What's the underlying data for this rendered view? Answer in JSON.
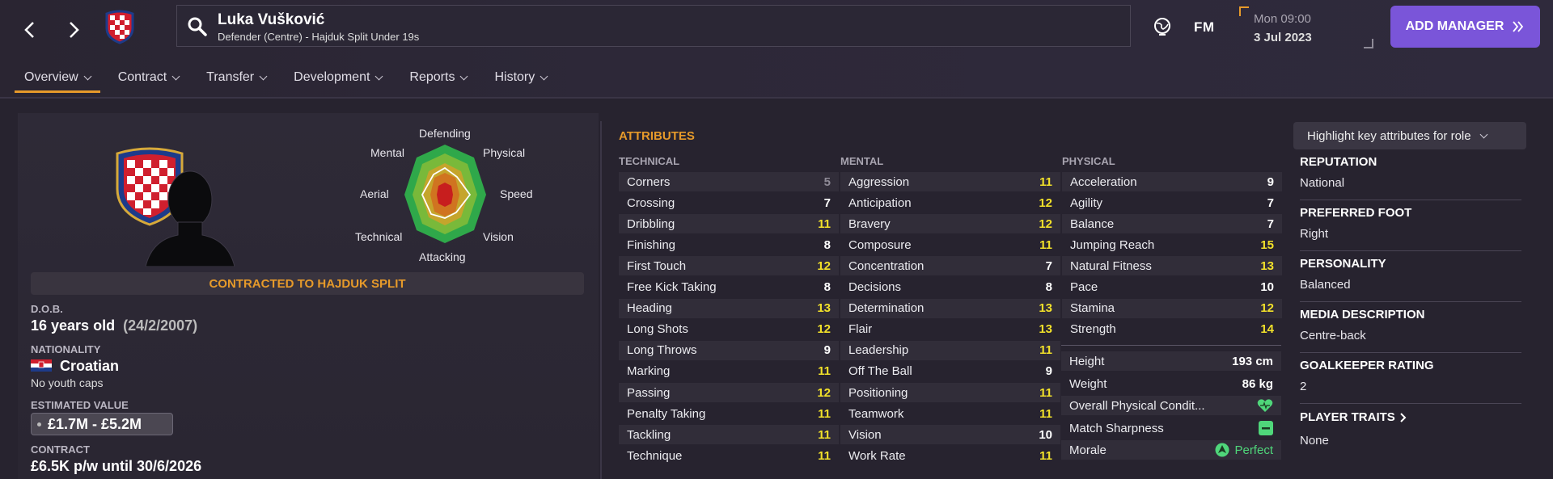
{
  "header": {
    "player_name": "Luka Vušković",
    "player_sub": "Defender (Centre) - Hajduk Split Under 19s",
    "logo_text": "FM",
    "date_day": "Mon 09:00",
    "date_date": "3 Jul 2023",
    "add_manager_label": "ADD MANAGER",
    "add_manager_color": "#7a55d9"
  },
  "tabs": [
    {
      "label": "Overview"
    },
    {
      "label": "Contract"
    },
    {
      "label": "Transfer"
    },
    {
      "label": "Development"
    },
    {
      "label": "Reports"
    },
    {
      "label": "History"
    }
  ],
  "radar": {
    "labels": {
      "defending": "Defending",
      "physical": "Physical",
      "speed": "Speed",
      "vision": "Vision",
      "attacking": "Attacking",
      "technical": "Technical",
      "aerial": "Aerial",
      "mental": "Mental"
    }
  },
  "profile": {
    "contracted_label": "CONTRACTED TO HAJDUK SPLIT",
    "dob_label": "D.O.B.",
    "age": "16 years old",
    "dob": "(24/2/2007)",
    "nationality_label": "NATIONALITY",
    "nationality": "Croatian",
    "caps": "No youth caps",
    "value_label": "ESTIMATED VALUE",
    "value": "£1.7M - £5.2M",
    "contract_label": "CONTRACT",
    "contract": "£6.5K p/w until 30/6/2026"
  },
  "attributes": {
    "title": "ATTRIBUTES",
    "technical_label": "TECHNICAL",
    "mental_label": "MENTAL",
    "physical_label": "PHYSICAL",
    "technical": [
      {
        "name": "Corners",
        "value": "5"
      },
      {
        "name": "Crossing",
        "value": "7"
      },
      {
        "name": "Dribbling",
        "value": "11"
      },
      {
        "name": "Finishing",
        "value": "8"
      },
      {
        "name": "First Touch",
        "value": "12"
      },
      {
        "name": "Free Kick Taking",
        "value": "8"
      },
      {
        "name": "Heading",
        "value": "13"
      },
      {
        "name": "Long Shots",
        "value": "12"
      },
      {
        "name": "Long Throws",
        "value": "9"
      },
      {
        "name": "Marking",
        "value": "11"
      },
      {
        "name": "Passing",
        "value": "12"
      },
      {
        "name": "Penalty Taking",
        "value": "11"
      },
      {
        "name": "Tackling",
        "value": "11"
      },
      {
        "name": "Technique",
        "value": "11"
      }
    ],
    "mental": [
      {
        "name": "Aggression",
        "value": "11"
      },
      {
        "name": "Anticipation",
        "value": "12"
      },
      {
        "name": "Bravery",
        "value": "12"
      },
      {
        "name": "Composure",
        "value": "11"
      },
      {
        "name": "Concentration",
        "value": "7"
      },
      {
        "name": "Decisions",
        "value": "8"
      },
      {
        "name": "Determination",
        "value": "13"
      },
      {
        "name": "Flair",
        "value": "13"
      },
      {
        "name": "Leadership",
        "value": "11"
      },
      {
        "name": "Off The Ball",
        "value": "9"
      },
      {
        "name": "Positioning",
        "value": "11"
      },
      {
        "name": "Teamwork",
        "value": "11"
      },
      {
        "name": "Vision",
        "value": "10"
      },
      {
        "name": "Work Rate",
        "value": "11"
      }
    ],
    "physical": [
      {
        "name": "Acceleration",
        "value": "9"
      },
      {
        "name": "Agility",
        "value": "7"
      },
      {
        "name": "Balance",
        "value": "7"
      },
      {
        "name": "Jumping Reach",
        "value": "15"
      },
      {
        "name": "Natural Fitness",
        "value": "13"
      },
      {
        "name": "Pace",
        "value": "10"
      },
      {
        "name": "Stamina",
        "value": "12"
      },
      {
        "name": "Strength",
        "value": "14"
      }
    ],
    "colors": {
      "low": "#8f8b97",
      "mid": "#ffffff",
      "high": "#f2e12a"
    }
  },
  "physical_info": {
    "height_label": "Height",
    "height": "193 cm",
    "weight_label": "Weight",
    "weight": "86 kg",
    "condition_label": "Overall Physical Condit...",
    "sharpness_label": "Match Sharpness",
    "morale_label": "Morale",
    "morale": "Perfect",
    "status_color": "#4fd67a"
  },
  "side_info": {
    "highlight_label": "Highlight key attributes for role",
    "reputation_label": "REPUTATION",
    "reputation": "National",
    "foot_label": "PREFERRED FOOT",
    "foot": "Right",
    "personality_label": "PERSONALITY",
    "personality": "Balanced",
    "media_label": "MEDIA DESCRIPTION",
    "media": "Centre-back",
    "gk_label": "GOALKEEPER RATING",
    "gk": "2",
    "traits_label": "PLAYER TRAITS",
    "traits": "None"
  },
  "accent_color": "#e69a2a"
}
